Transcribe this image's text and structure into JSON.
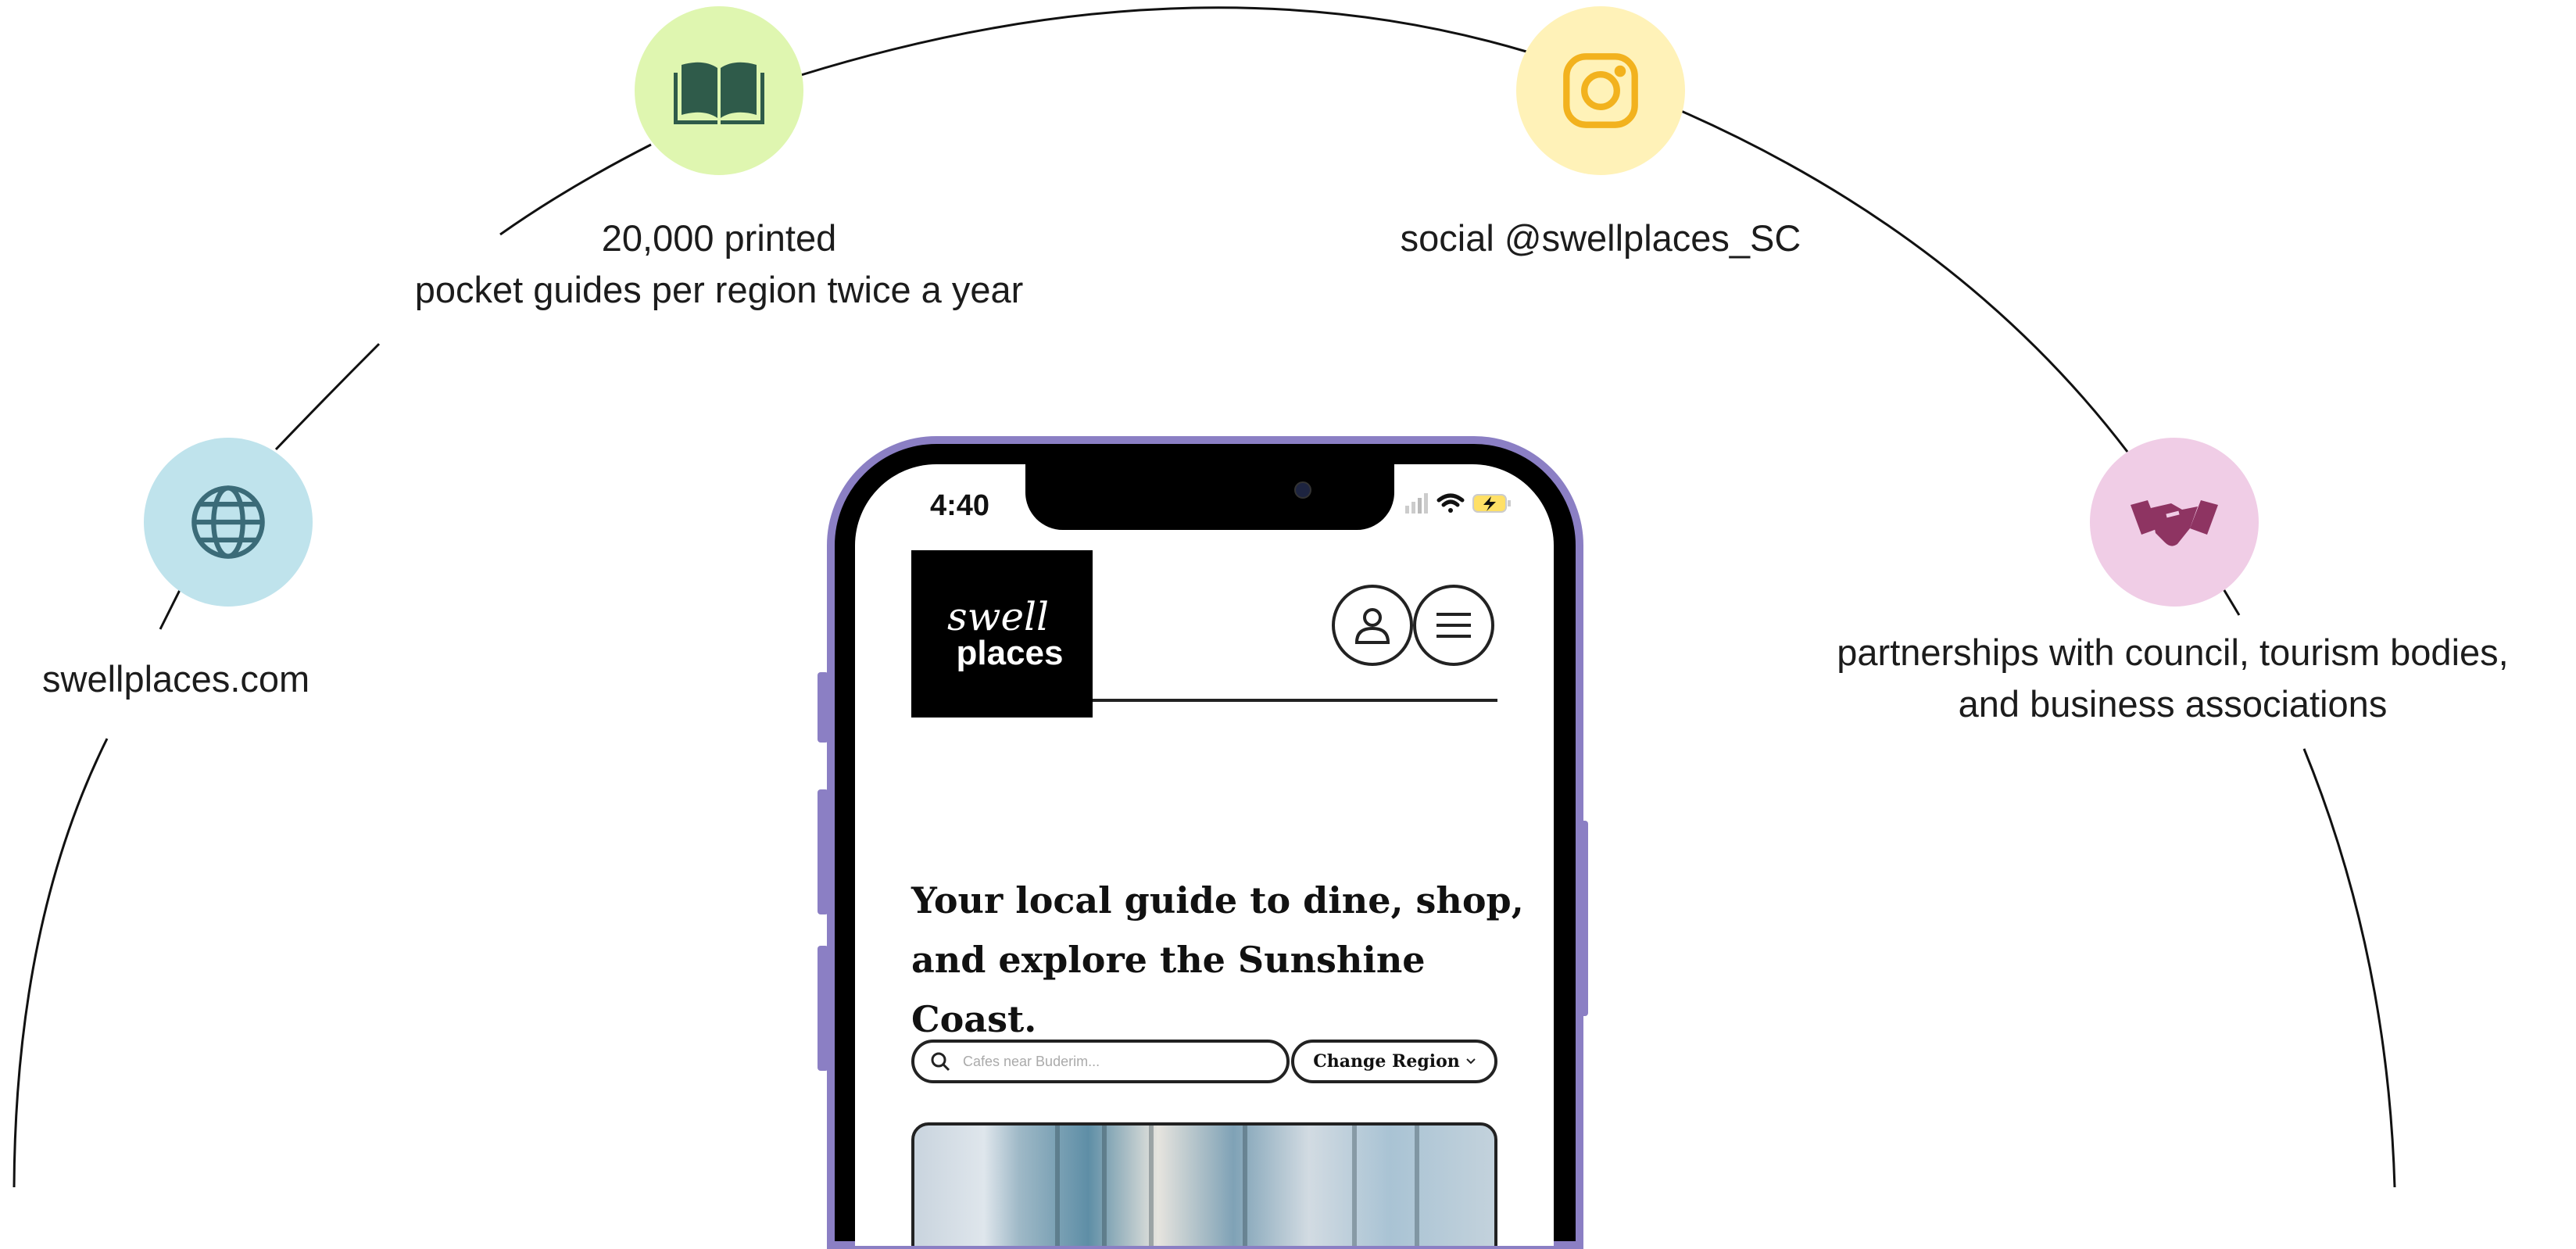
{
  "nodes": [
    {
      "id": "website",
      "label": "swellplaces.com",
      "icon": "globe-icon",
      "color": "#bfe3ec",
      "icon_color": "#3b6b78"
    },
    {
      "id": "print",
      "label_lines": [
        "20,000 printed",
        "pocket guides per region twice a year"
      ],
      "icon": "open-book-icon",
      "color": "#dff6b0",
      "icon_color": "#2f5b4a"
    },
    {
      "id": "social",
      "label": "social @swellplaces_SC",
      "icon": "instagram-icon",
      "color": "#fff2b8",
      "icon_color": "#f2b21e"
    },
    {
      "id": "partners",
      "label_lines": [
        "partnerships with council, tourism bodies,",
        "and business associations"
      ],
      "icon": "handshake-icon",
      "color": "#f0cde6",
      "icon_color": "#8e3462"
    }
  ],
  "phone": {
    "time": "4:40",
    "logo_line1": "swell",
    "logo_line2": "places",
    "headline_line1": "Your local guide to dine, shop,",
    "headline_line2": "and explore the Sunshine Coast.",
    "search_placeholder": "Cafes near Buderim...",
    "region_button": "Change Region"
  },
  "colors": {
    "phone_frame": "#8b7fc4",
    "arc": "#111111"
  }
}
